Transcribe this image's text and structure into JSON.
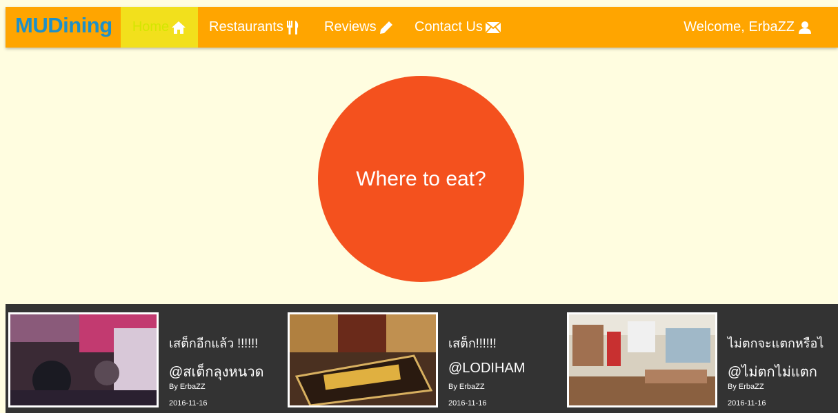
{
  "nav": {
    "brand": "MUDining",
    "items": [
      {
        "label": "Home",
        "icon": "home-icon"
      },
      {
        "label": "Restaurants",
        "icon": "fork-knife-icon"
      },
      {
        "label": "Reviews",
        "icon": "pencil-icon"
      },
      {
        "label": "Contact Us",
        "icon": "envelope-icon"
      }
    ],
    "active": "Home",
    "welcome": "Welcome, ErbaZZ",
    "user_icon": "user-icon"
  },
  "hero": {
    "label": "Where to eat?"
  },
  "reviews": [
    {
      "title": "เสต็กอีกแล้ว !!!!!!",
      "place": "@สเต็กลุงหนวด",
      "author": "By ErbaZZ",
      "date": "2016-11-16"
    },
    {
      "title": "เสต็ก!!!!!!",
      "place": "@LODIHAM",
      "author": "By ErbaZZ",
      "date": "2016-11-16"
    },
    {
      "title": "ไม่ตกจะแตกหรือไ",
      "place": "@ไม่ตกไม่แตก",
      "author": "By ErbaZZ",
      "date": "2016-11-16"
    }
  ],
  "colors": {
    "navbar": "#ffa500",
    "active_tab": "#f2e01c",
    "brand": "#1e90c8",
    "hero": "#f4511e",
    "background": "#fffde0",
    "strip": "#333333"
  }
}
